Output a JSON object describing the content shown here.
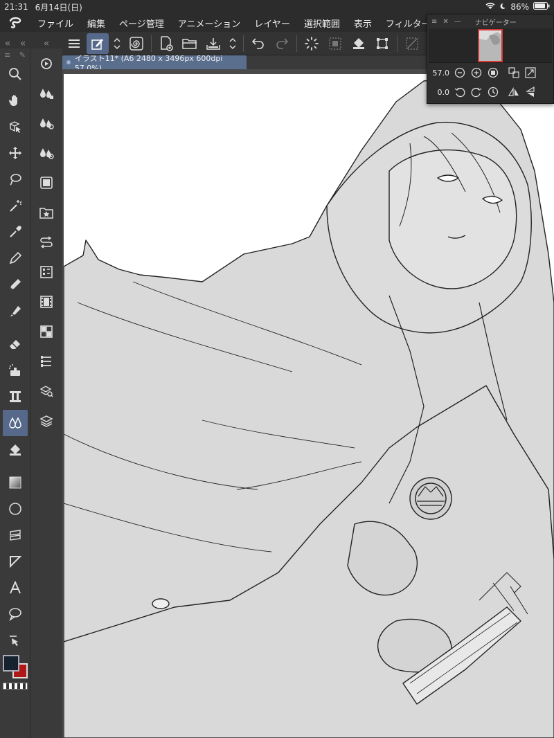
{
  "status": {
    "time": "21:31",
    "date": "6月14日(日)",
    "battery": "86%"
  },
  "menu": [
    "ファイル",
    "編集",
    "ページ管理",
    "アニメーション",
    "レイヤー",
    "選択範囲",
    "表示",
    "フィルター"
  ],
  "document_tab": {
    "title": "イラスト11* (A6 2480 x 3496px 600dpi 57.0%)"
  },
  "navigator": {
    "title": "ナビゲーター",
    "zoom": "57.0",
    "rotation": "0.0"
  },
  "colors": {
    "main_color": "#16222e",
    "sub_color": "#b01818",
    "accent": "#56698a"
  },
  "tools": [
    "zoom-icon",
    "hand-icon",
    "object-select-icon",
    "move-icon",
    "lasso-icon",
    "magic-wand-icon",
    "eyedropper-icon",
    "pen-icon",
    "pencil-icon",
    "marker-icon",
    "eraser-icon",
    "airbrush-icon",
    "stamp-icon",
    "blend-icon",
    "fill-icon",
    "gradient-icon",
    "circle-icon",
    "ruler-icon",
    "line-icon",
    "text-icon",
    "balloon-icon",
    "correct-line-icon"
  ]
}
